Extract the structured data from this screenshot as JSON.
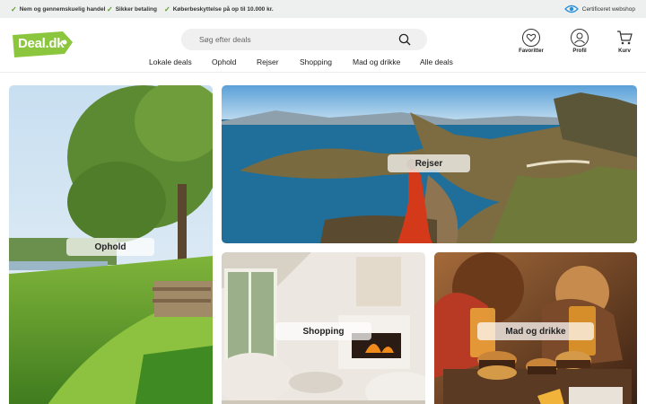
{
  "usp": [
    {
      "icon": "check-icon",
      "text": "Nem og gennemskuelig handel"
    },
    {
      "icon": "check-icon",
      "text": "Sikker betaling"
    },
    {
      "icon": "check-icon",
      "text": "Køberbeskyttelse på op til 10.000 kr."
    }
  ],
  "certified": {
    "icon": "eye-icon",
    "text": "Certificeret webshop"
  },
  "logo": {
    "text": "Deal.dk",
    "color": "#8cc63f"
  },
  "search": {
    "placeholder": "Søg efter deals",
    "value": "",
    "icon": "search-icon"
  },
  "nav": [
    "Lokale deals",
    "Ophold",
    "Rejser",
    "Shopping",
    "Mad og drikke",
    "Alle deals"
  ],
  "header_icons": [
    {
      "icon": "heart-icon",
      "label": "Favoritter"
    },
    {
      "icon": "user-icon",
      "label": "Profil"
    },
    {
      "icon": "cart-icon",
      "label": "Kurv"
    }
  ],
  "tiles": {
    "ophold": "Ophold",
    "rejser": "Rejser",
    "shopping": "Shopping",
    "mad": "Mad og drikke"
  },
  "colors": {
    "accent": "#8cc63f",
    "check": "#5a9a1e",
    "topbar": "#eef0f0"
  }
}
